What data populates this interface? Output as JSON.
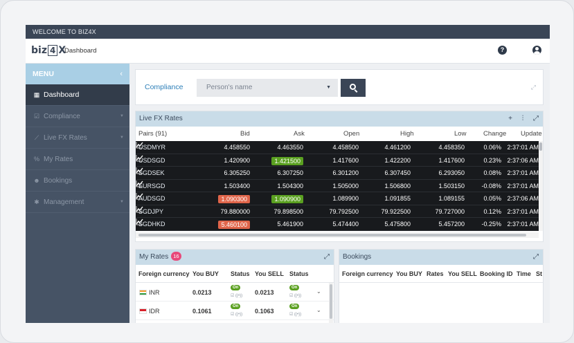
{
  "header": {
    "welcome": "WELCOME TO BIZ4X",
    "logo": {
      "part1": "biz",
      "part2": "4",
      "part3": "X"
    },
    "page": "Dashboard",
    "help_icon": "question-circle-icon",
    "user_icon": "user-circle-icon"
  },
  "sidebar": {
    "menu_title": "MENU",
    "items": [
      {
        "label": "Dashboard",
        "icon": "dashboard-icon",
        "glyph": "▦",
        "active": true,
        "caret": ""
      },
      {
        "label": "Compliance",
        "icon": "checkbox-icon",
        "glyph": "☑",
        "active": false,
        "caret": "▼"
      },
      {
        "label": "Live FX Rates",
        "icon": "chart-icon",
        "glyph": "⟋",
        "active": false,
        "caret": "▼"
      },
      {
        "label": "My Rates",
        "icon": "percent-icon",
        "glyph": "%",
        "active": false,
        "caret": ""
      },
      {
        "label": "Bookings",
        "icon": "users-icon",
        "glyph": "☻",
        "active": false,
        "caret": ""
      },
      {
        "label": "Management",
        "icon": "gear-icon",
        "glyph": "✱",
        "active": false,
        "caret": "▼"
      }
    ]
  },
  "compliance": {
    "title": "Compliance",
    "placeholder": "Person's name"
  },
  "fx": {
    "title": "Live FX Rates",
    "columns": {
      "pairs": "Pairs (91)",
      "bid": "Bid",
      "ask": "Ask",
      "open": "Open",
      "high": "High",
      "low": "Low",
      "change": "Change",
      "update": "Update"
    },
    "rows": [
      {
        "pair": "USDMYR",
        "bid": "4.458550",
        "bid_hl": "",
        "ask": "4.463550",
        "ask_hl": "",
        "open": "4.458500",
        "high": "4.461200",
        "low": "4.458350",
        "change": "0.06%",
        "update": "2:37:01 AM"
      },
      {
        "pair": "USDSGD",
        "bid": "1.420900",
        "bid_hl": "",
        "ask": "1.421500",
        "ask_hl": "green",
        "open": "1.417600",
        "high": "1.422200",
        "low": "1.417600",
        "change": "0.23%",
        "update": "2:37:06 AM"
      },
      {
        "pair": "SGDSEK",
        "bid": "6.305250",
        "bid_hl": "",
        "ask": "6.307250",
        "ask_hl": "",
        "open": "6.301200",
        "high": "6.307450",
        "low": "6.293050",
        "change": "0.08%",
        "update": "2:37:01 AM"
      },
      {
        "pair": "EURSGD",
        "bid": "1.503400",
        "bid_hl": "",
        "ask": "1.504300",
        "ask_hl": "",
        "open": "1.505000",
        "high": "1.506800",
        "low": "1.503150",
        "change": "-0.08%",
        "update": "2:37:01 AM"
      },
      {
        "pair": "AUDSGD",
        "bid": "1.090300",
        "bid_hl": "red",
        "ask": "1.090900",
        "ask_hl": "green",
        "open": "1.089900",
        "high": "1.091855",
        "low": "1.089155",
        "change": "0.05%",
        "update": "2:37:06 AM"
      },
      {
        "pair": "SGDJPY",
        "bid": "79.880000",
        "bid_hl": "",
        "ask": "79.898500",
        "ask_hl": "",
        "open": "79.792500",
        "high": "79.922500",
        "low": "79.727000",
        "change": "0.12%",
        "update": "2:37:01 AM"
      },
      {
        "pair": "SGDHKD",
        "bid": "5.460100",
        "bid_hl": "red",
        "ask": "5.461900",
        "ask_hl": "",
        "open": "5.474400",
        "high": "5.475800",
        "low": "5.457200",
        "change": "-0.25%",
        "update": "2:37:01 AM"
      }
    ]
  },
  "my_rates": {
    "title": "My Rates",
    "count": "16",
    "columns": {
      "currency": "Foreign currency",
      "buy": "You BUY",
      "status": "Status",
      "sell": "You SELL",
      "status2": "Status"
    },
    "rows": [
      {
        "currency": "INR",
        "flag": "india-flag",
        "buy": "0.0213",
        "sell": "0.0213",
        "status": "On"
      },
      {
        "currency": "IDR",
        "flag": "indonesia-flag",
        "buy": "0.1061",
        "sell": "0.1063",
        "status": "On"
      }
    ]
  },
  "bookings": {
    "title": "Bookings",
    "columns": {
      "currency": "Foreign currency",
      "buy": "You BUY",
      "rates": "Rates",
      "sell": "You SELL",
      "id": "Booking ID",
      "time": "Time",
      "status": "St"
    }
  },
  "colors": {
    "nav_dark": "#3a4556",
    "sidebar": "#465365",
    "menu_head": "#a9cfe5",
    "panel_head": "#c9dce8",
    "up": "#5aa020",
    "down": "#e0654a",
    "badge": "#e8497a"
  }
}
